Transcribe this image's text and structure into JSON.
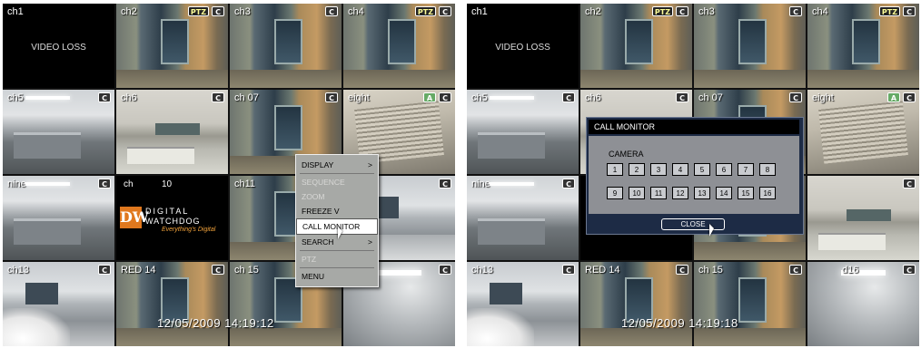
{
  "left": {
    "channels": {
      "ch1": {
        "label": "ch1",
        "body": "VIDEO LOSS"
      },
      "ch2": {
        "label": "ch2"
      },
      "ch3": {
        "label": "ch3"
      },
      "ch4": {
        "label": "ch4"
      },
      "ch5": {
        "label": "ch5"
      },
      "ch6": {
        "label": "ch6"
      },
      "ch7": {
        "label": "ch   07"
      },
      "ch8": {
        "label": "eight"
      },
      "ch9": {
        "label": "nine"
      },
      "ch10": {
        "title": "ch",
        "num": "10"
      },
      "ch11": {
        "label": "ch11"
      },
      "ch12": {
        "label": ""
      },
      "ch13": {
        "label": "ch13"
      },
      "ch14": {
        "label": "RED    14"
      },
      "ch15": {
        "label": "ch        15"
      },
      "ch16": {
        "label": "   d16"
      }
    },
    "timestamp": "12/05/2009 14:19:12",
    "context_menu": {
      "items": [
        {
          "label": "DISPLAY",
          "arrow": ">",
          "enabled": true
        },
        {
          "label": "SEQUENCE",
          "enabled": false
        },
        {
          "label": "ZOOM",
          "enabled": false
        },
        {
          "label": "FREEZE V",
          "enabled": true
        },
        {
          "label": "CALL MONITOR",
          "enabled": true,
          "highlighted": true
        },
        {
          "label": "SEARCH",
          "arrow": ">",
          "enabled": true
        },
        {
          "label": "PTZ",
          "enabled": false
        },
        {
          "label": "MENU",
          "enabled": true
        }
      ]
    }
  },
  "right": {
    "channels": {
      "ch1": {
        "label": "ch1",
        "body": "VIDEO LOSS"
      },
      "ch2": {
        "label": "ch2"
      },
      "ch3": {
        "label": "ch3"
      },
      "ch4": {
        "label": "ch4"
      },
      "ch5": {
        "label": "ch5"
      },
      "ch6": {
        "label": "ch6"
      },
      "ch7": {
        "label": "ch   07"
      },
      "ch8": {
        "label": "eight"
      },
      "ch9": {
        "label": "nine"
      },
      "ch11": {
        "label": ""
      },
      "ch12": {
        "label": ""
      },
      "ch13": {
        "label": "ch13"
      },
      "ch14": {
        "label": "RED    14"
      },
      "ch15": {
        "label": "ch        15"
      },
      "ch16": {
        "label": "d16"
      }
    },
    "timestamp": "12/05/2009 14:19:18",
    "dialog": {
      "title": "CALL MONITOR",
      "camera_label": "CAMERA",
      "buttons": [
        "1",
        "2",
        "3",
        "4",
        "5",
        "6",
        "7",
        "8",
        "9",
        "10",
        "11",
        "12",
        "13",
        "14",
        "15",
        "16"
      ],
      "close_label": "CLOSE"
    }
  },
  "logo": {
    "brand_line1": "DIGITAL",
    "brand_line2": "WATCHDOG",
    "tagline": "Everything's Digital",
    "mark": "DW"
  },
  "badges": {
    "camera": "C",
    "ptz": "PTZ",
    "audio": "A"
  },
  "colors": {
    "menu_bg": "#a7a9a6",
    "dialog_bg": "#1d2b45",
    "logo_orange": "#e0781e"
  }
}
